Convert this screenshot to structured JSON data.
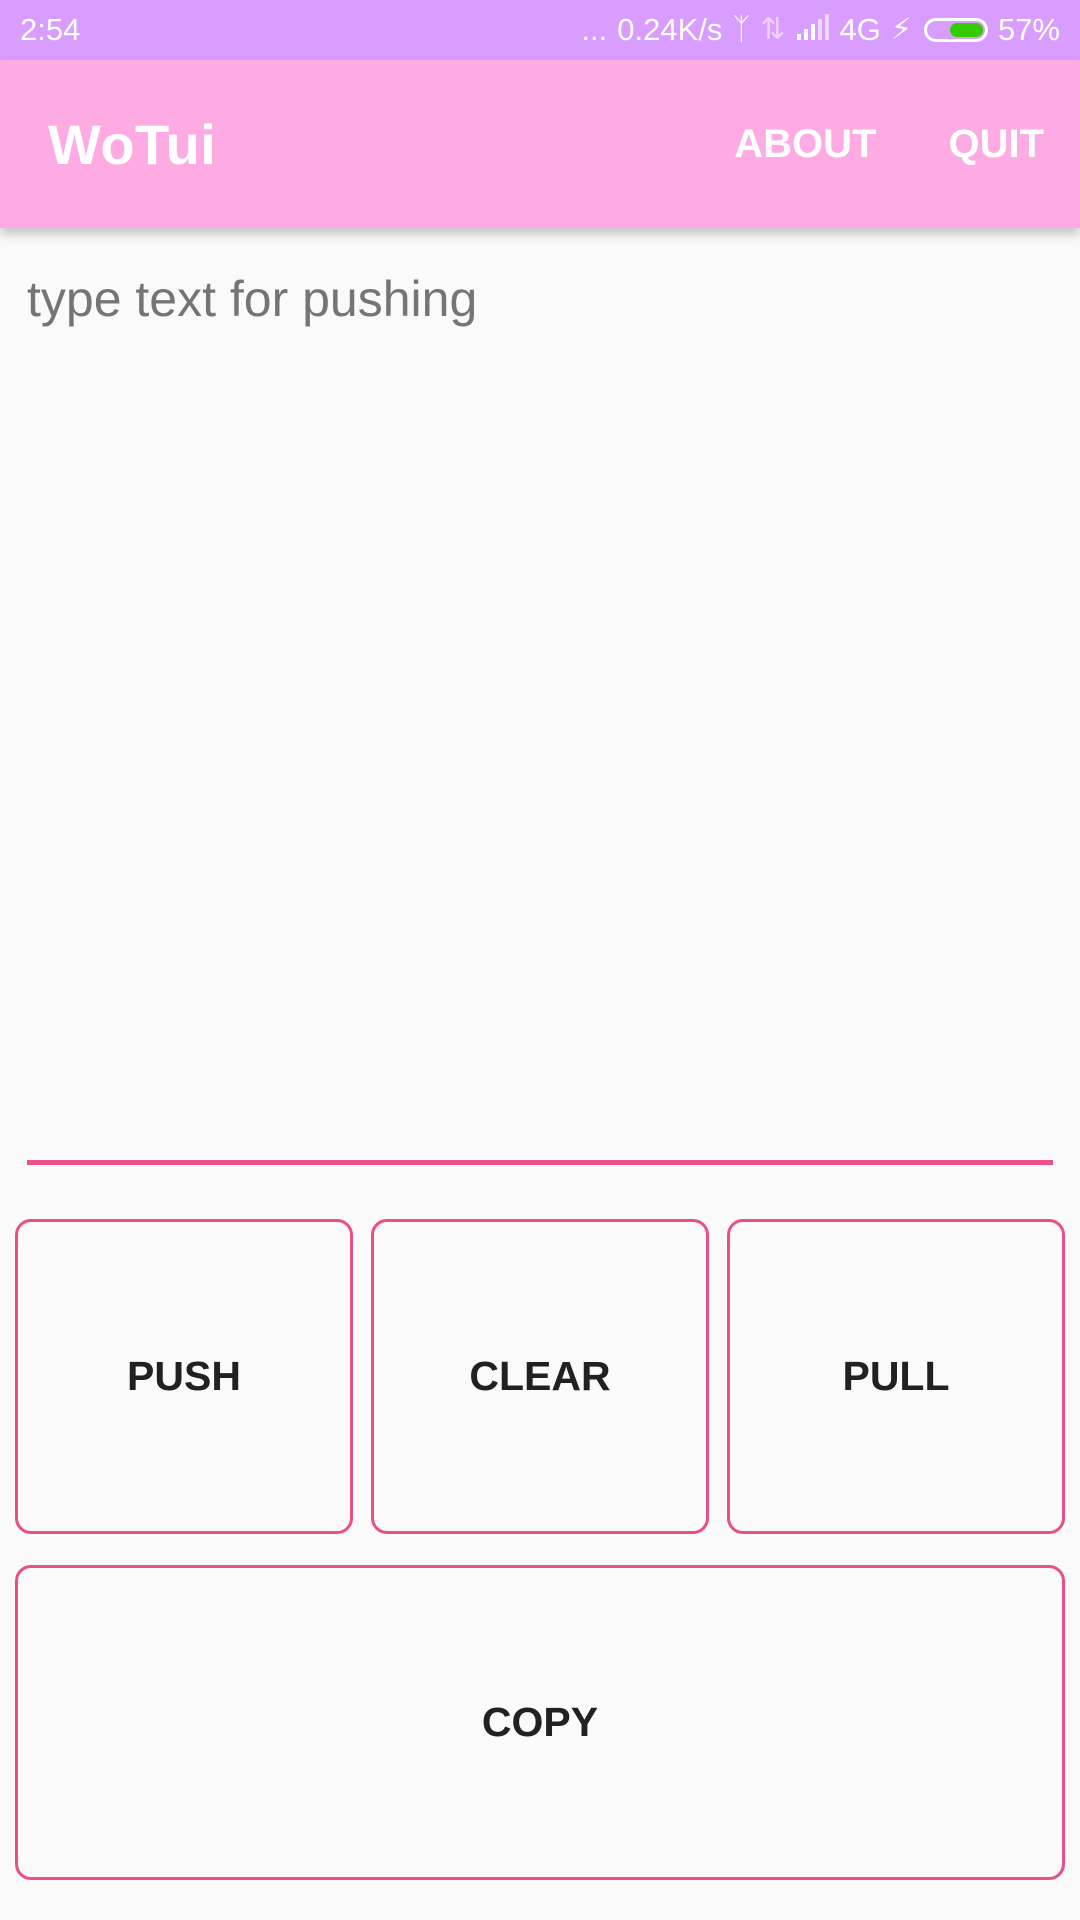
{
  "status_bar": {
    "time": "2:54",
    "dots": "...",
    "network_speed": "0.24K/s",
    "network_type": "4G",
    "battery_percent": "57%",
    "battery_level": 0.57,
    "icons": [
      "bluetooth-icon",
      "data-arrows-icon",
      "signal-icon",
      "charging-icon",
      "battery-icon"
    ]
  },
  "app_bar": {
    "title": "WoTui",
    "actions": {
      "about": "ABOUT",
      "quit": "QUIT"
    }
  },
  "editor": {
    "value": "",
    "placeholder": "type text for pushing"
  },
  "buttons": {
    "push": "PUSH",
    "clear": "CLEAR",
    "pull": "PULL",
    "copy": "COPY"
  },
  "colors": {
    "status_bar": "#d99cff",
    "app_bar": "#ffabe3",
    "accent": "#f0508c",
    "background": "#fafafa"
  }
}
